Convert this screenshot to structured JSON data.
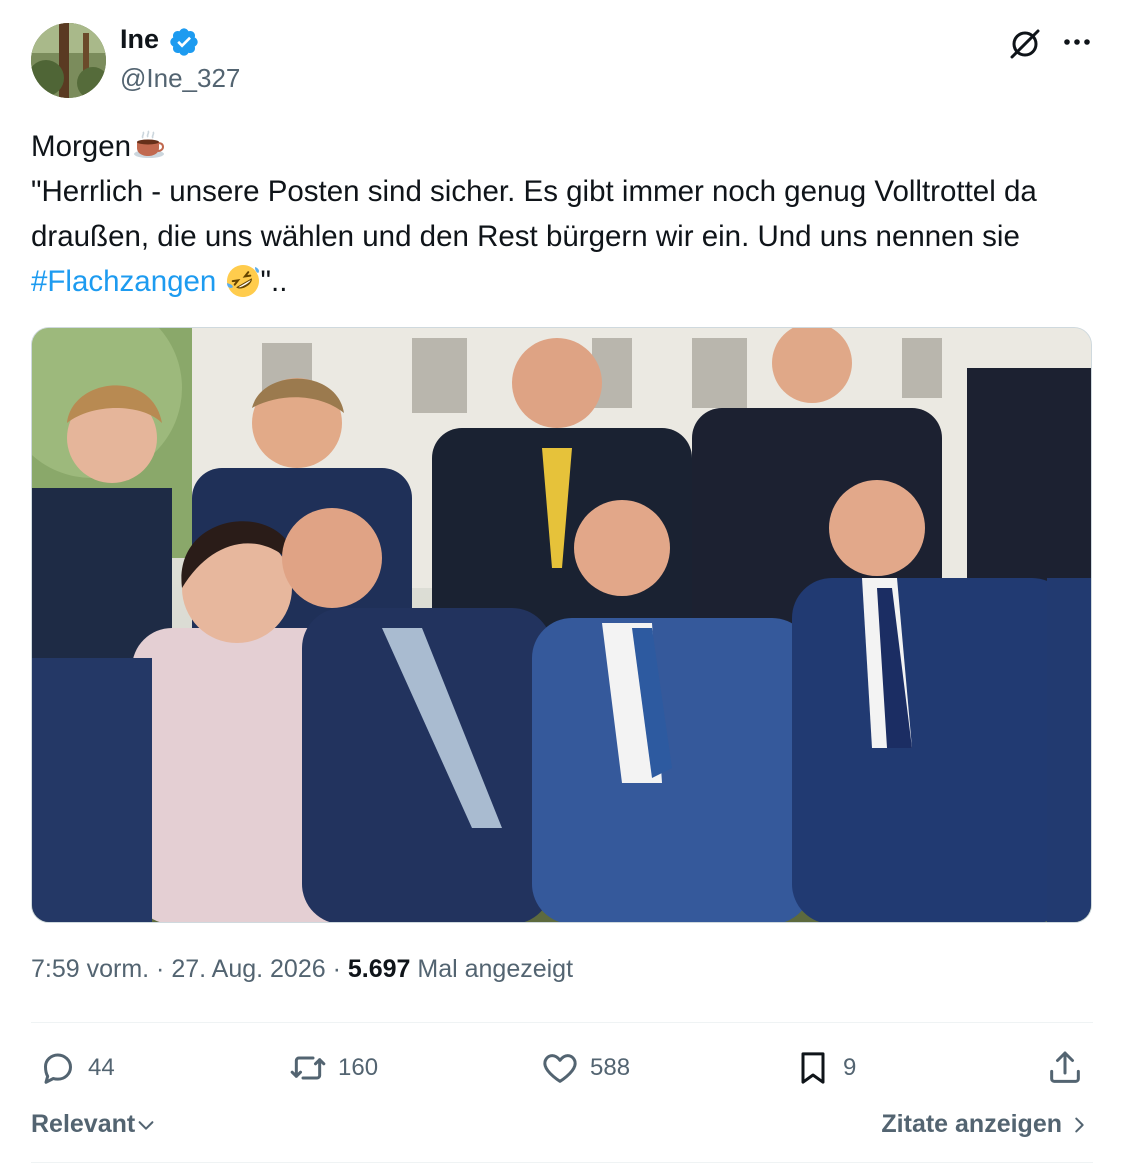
{
  "author": {
    "display_name": "Ine",
    "handle": "@Ine_327",
    "verified": true
  },
  "tweet": {
    "line1": "Morgen",
    "line2": "\"Herrlich - unsere Posten sind sicher. Es gibt immer noch genug Volltrottel da draußen, die uns wählen und den Rest bürgern wir ein. Und uns nennen sie ",
    "hashtag": "#Flachzangen",
    "suffix": "\"..",
    "emoji_1": "coffee-icon",
    "emoji_2": "rolling-on-floor-laughing-icon"
  },
  "meta": {
    "time": "7:59 vorm.",
    "separator": " · ",
    "date": "27. Aug. 2026",
    "views_count": "5.697",
    "views_label": "Mal angezeigt"
  },
  "actions": {
    "replies": "44",
    "reposts": "160",
    "likes": "588",
    "bookmarks": "9"
  },
  "footer": {
    "sort_label": "Relevant",
    "quotes_label": "Zitate anzeigen"
  },
  "colors": {
    "accent": "#1d9bf0",
    "text": "#0f1419",
    "secondary": "#536471"
  }
}
